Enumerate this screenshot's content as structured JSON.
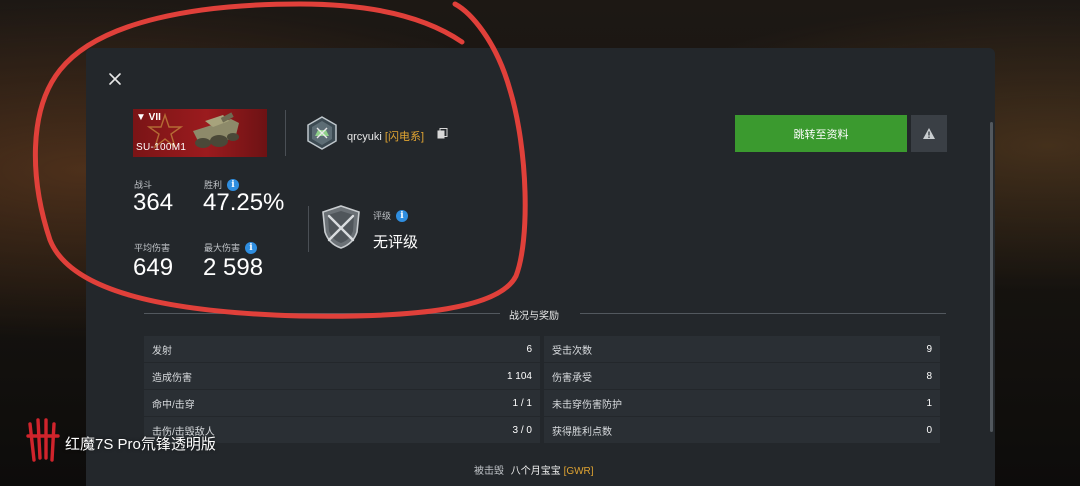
{
  "dialog": {
    "close_label": "×"
  },
  "tank": {
    "tier": "▼ VII",
    "name": "SU-100M1"
  },
  "player": {
    "name": "qrcyuki",
    "clan_tag": "[闪电系]"
  },
  "stats": {
    "battles_label": "战斗",
    "battles_value": "364",
    "winrate_label": "胜利",
    "winrate_value": "47.25%",
    "avg_damage_label": "平均伤害",
    "avg_damage_value": "649",
    "max_damage_label": "最大伤害",
    "max_damage_value": "2 598",
    "rating_label": "评级",
    "rating_value": "无评级"
  },
  "actions": {
    "profile_button": "跳转至资料",
    "report_icon": "warning-icon"
  },
  "battle_report": {
    "title": "战况与奖励",
    "left_rows": [
      {
        "label": "发射",
        "value": "6"
      },
      {
        "label": "造成伤害",
        "value": "1 104"
      },
      {
        "label": "命中/击穿",
        "value": "1 / 1"
      },
      {
        "label": "击伤/击毁敌人",
        "value": "3 / 0"
      }
    ],
    "right_rows": [
      {
        "label": "受击次数",
        "value": "9"
      },
      {
        "label": "伤害承受",
        "value": "8"
      },
      {
        "label": "未击穿伤害防护",
        "value": "1"
      },
      {
        "label": "获得胜利点数",
        "value": "0"
      }
    ]
  },
  "footer": {
    "destroyed_by_label": "被击毁",
    "killer_name": "八个月宝宝",
    "killer_clan": "[GWR]"
  },
  "overlay": {
    "device_watermark": "红魔7S Pro氘锋透明版"
  },
  "colors": {
    "panel_bg": "#23272b",
    "accent_green": "#3b9a2f",
    "clan_orange": "#e0a432",
    "info_blue": "#2f8ee0",
    "annotation_red": "#e0403a"
  }
}
